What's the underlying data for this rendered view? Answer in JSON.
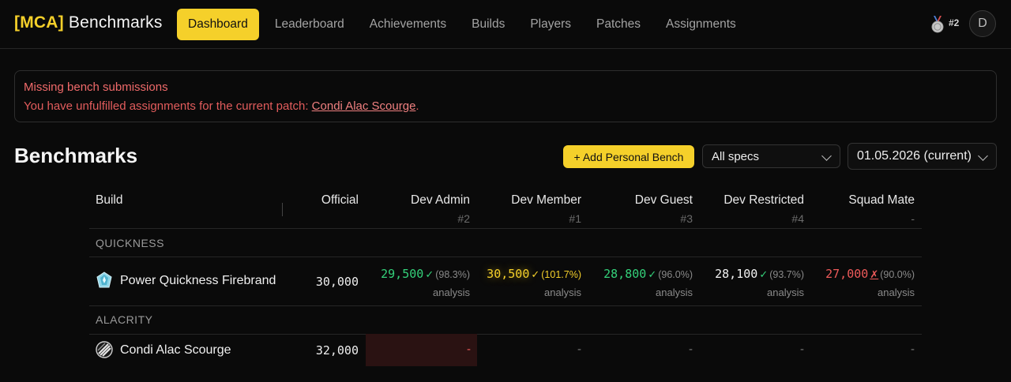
{
  "nav": {
    "brand_tag": "[MCA]",
    "brand_name": "Benchmarks",
    "links": [
      "Dashboard",
      "Leaderboard",
      "Achievements",
      "Builds",
      "Players",
      "Patches",
      "Assignments"
    ],
    "active": "Dashboard",
    "rank": "#2",
    "avatar_initial": "D",
    "medal_icon": "silver-medal-icon"
  },
  "alert": {
    "title": "Missing bench submissions",
    "message_prefix": "You have unfulfilled assignments for the current patch: ",
    "link": "Condi Alac Scourge",
    "message_suffix": "."
  },
  "page": {
    "title": "Benchmarks",
    "add_button": "+ Add Personal Bench",
    "spec_filter": "All specs",
    "patch_select": "01.05.2026 (current)"
  },
  "table": {
    "columns": {
      "build": "Build",
      "official": "Official",
      "players": [
        {
          "name": "Dev Admin",
          "rank": "#2"
        },
        {
          "name": "Dev Member",
          "rank": "#1"
        },
        {
          "name": "Dev Guest",
          "rank": "#3"
        },
        {
          "name": "Dev Restricted",
          "rank": "#4"
        },
        {
          "name": "Squad Mate",
          "rank": "-"
        }
      ]
    },
    "groups": [
      {
        "label": "QUICKNESS",
        "rows": [
          {
            "build": "Power Quickness Firebrand",
            "icon": "firebrand-icon",
            "official": "30,000",
            "cells": [
              {
                "value": "29,500",
                "mark": "✓",
                "pct": "(98.3%)",
                "link": "analysis",
                "status": "green"
              },
              {
                "value": "30,500",
                "mark": "✓",
                "pct": "(101.7%)",
                "link": "analysis",
                "status": "yellow"
              },
              {
                "value": "28,800",
                "mark": "✓",
                "pct": "(96.0%)",
                "link": "analysis",
                "status": "green"
              },
              {
                "value": "28,100",
                "mark": "✓",
                "pct": "(93.7%)",
                "link": "analysis",
                "status": "white"
              },
              {
                "value": "27,000",
                "mark": "✗",
                "pct": "(90.0%)",
                "link": "analysis",
                "status": "red"
              }
            ]
          }
        ]
      },
      {
        "label": "ALACRITY",
        "rows": [
          {
            "build": "Condi Alac Scourge",
            "icon": "scourge-icon",
            "official": "32,000",
            "cells": [
              "-",
              "-",
              "-",
              "-",
              "-"
            ]
          }
        ]
      }
    ]
  },
  "colors": {
    "accent": "#f5d02a",
    "good": "#34d17a",
    "bad": "#ee5a5a"
  }
}
